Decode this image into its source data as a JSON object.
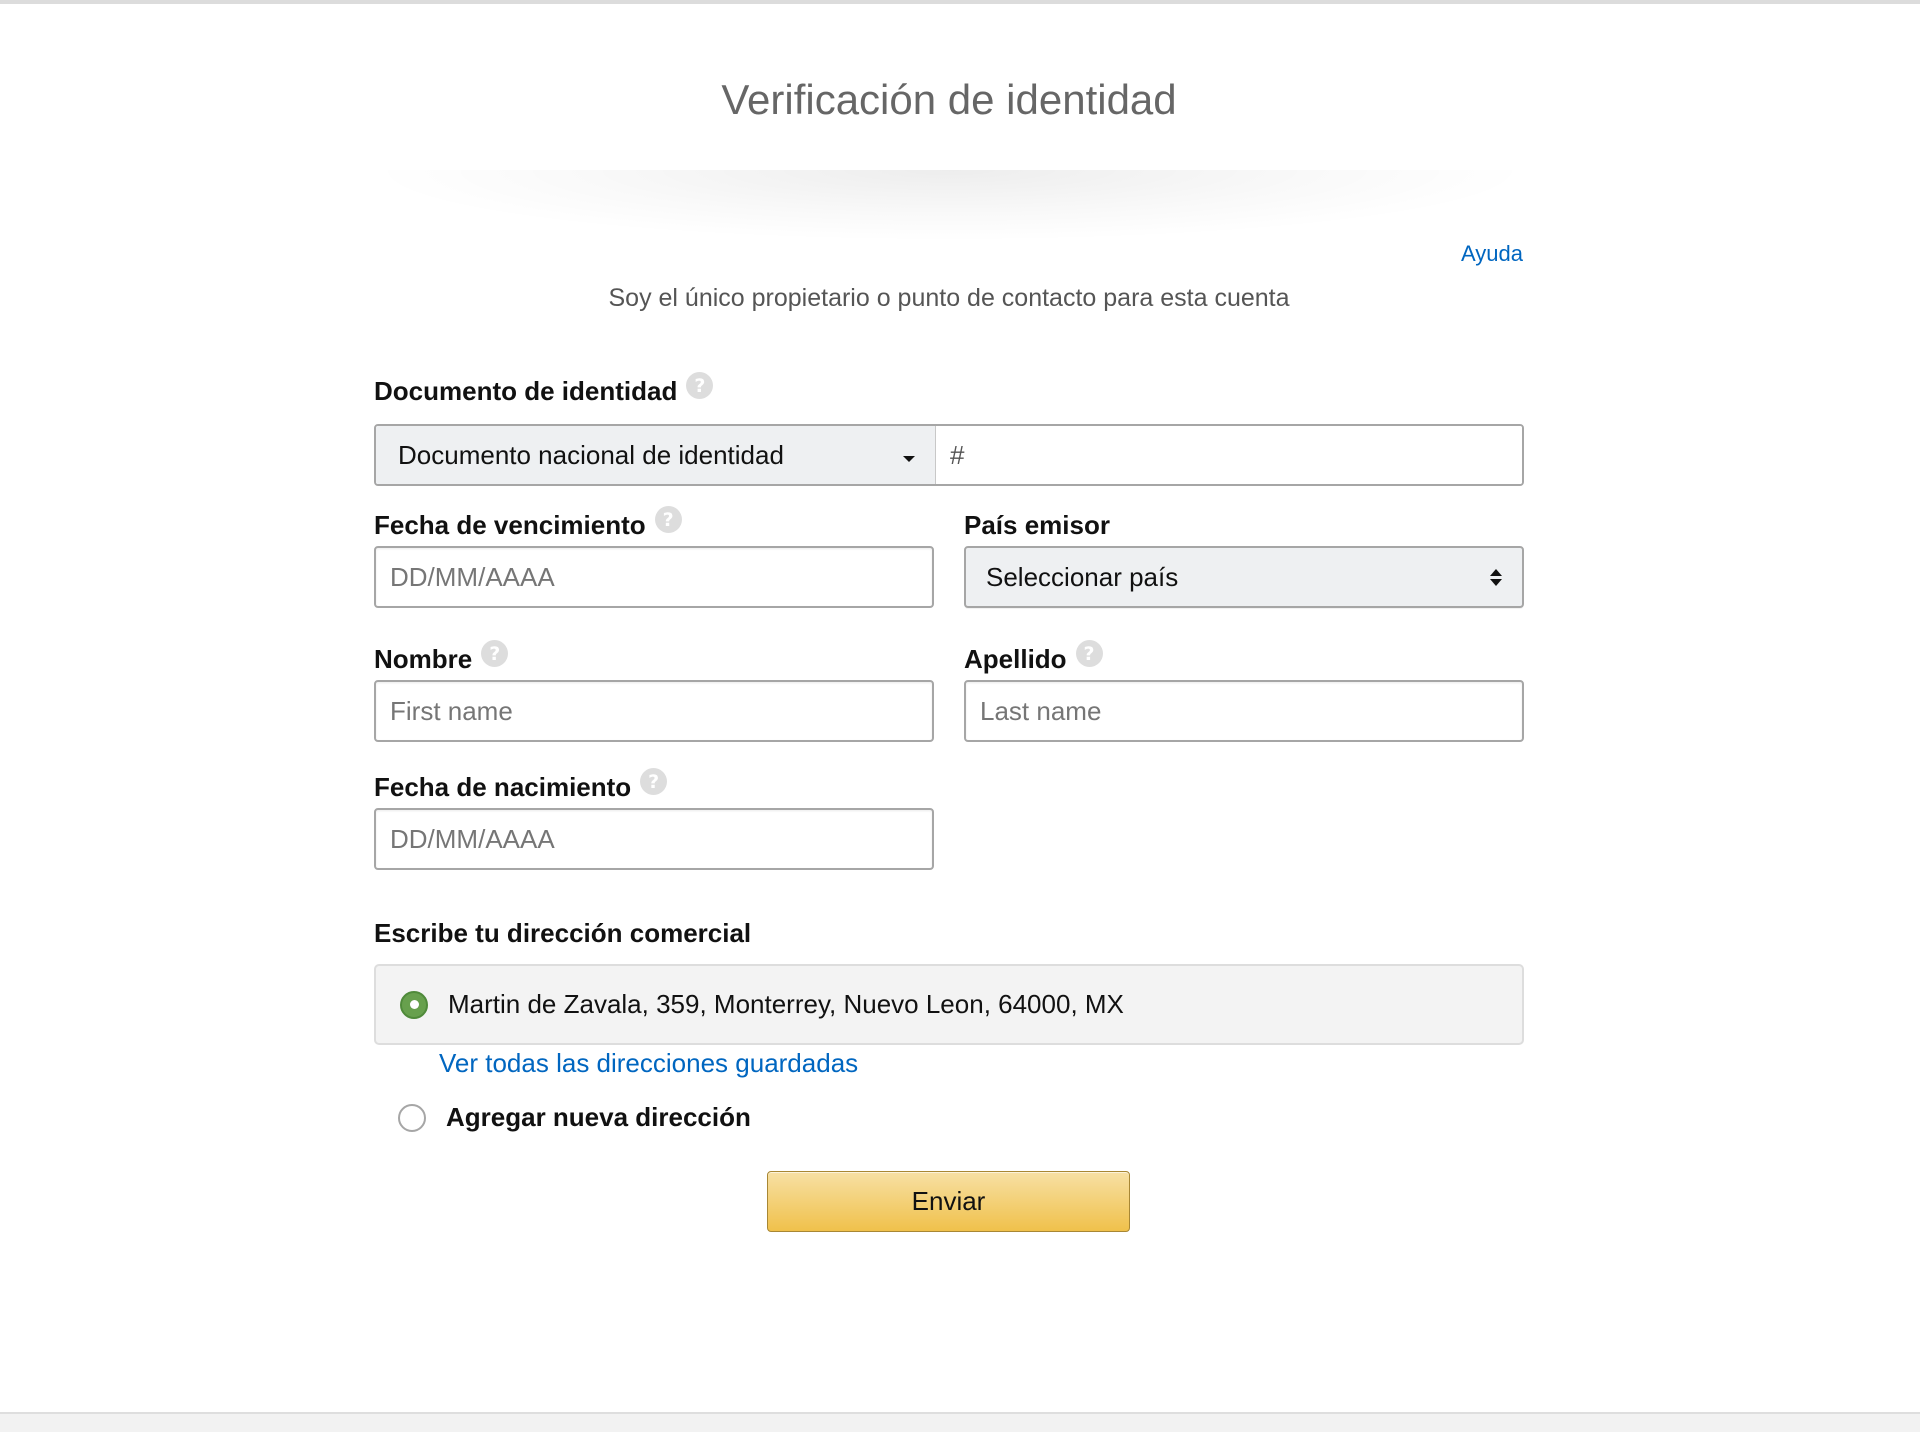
{
  "header": {
    "title": "Verificación de identidad",
    "help_link": "Ayuda",
    "subtitle": "Soy el único propietario o punto de contacto para esta cuenta"
  },
  "form": {
    "id_document": {
      "label": "Documento de identidad",
      "type_selected": "Documento nacional de identidad",
      "number_value": "",
      "number_placeholder": "#"
    },
    "expiration_date": {
      "label": "Fecha de vencimiento",
      "value": "",
      "placeholder": "DD/MM/AAAA"
    },
    "issuing_country": {
      "label": "País emisor",
      "selected": "Seleccionar país"
    },
    "first_name": {
      "label": "Nombre",
      "value": "",
      "placeholder": "First name"
    },
    "last_name": {
      "label": "Apellido",
      "value": "",
      "placeholder": "Last name"
    },
    "birth_date": {
      "label": "Fecha de nacimiento",
      "value": "",
      "placeholder": "DD/MM/AAAA"
    },
    "address": {
      "label": "Escribe tu dirección comercial",
      "selected_address": "Martin de Zavala, 359, Monterrey, Nuevo Leon, 64000, MX",
      "view_saved_link": "Ver todas las direcciones guardadas",
      "add_new_label": "Agregar nueva dirección"
    },
    "submit_label": "Enviar"
  },
  "icons": {
    "help": "question-mark-icon",
    "dropdown": "caret-down-icon",
    "select": "up-down-arrows-icon",
    "radio_selected": "radio-checked-icon",
    "radio_unselected": "radio-unchecked-icon"
  },
  "colors": {
    "link": "#0066c0",
    "radio_selected": "#67a04d",
    "button_top": "#f7e0a4",
    "button_bottom": "#f0c14b",
    "title": "#666666"
  }
}
